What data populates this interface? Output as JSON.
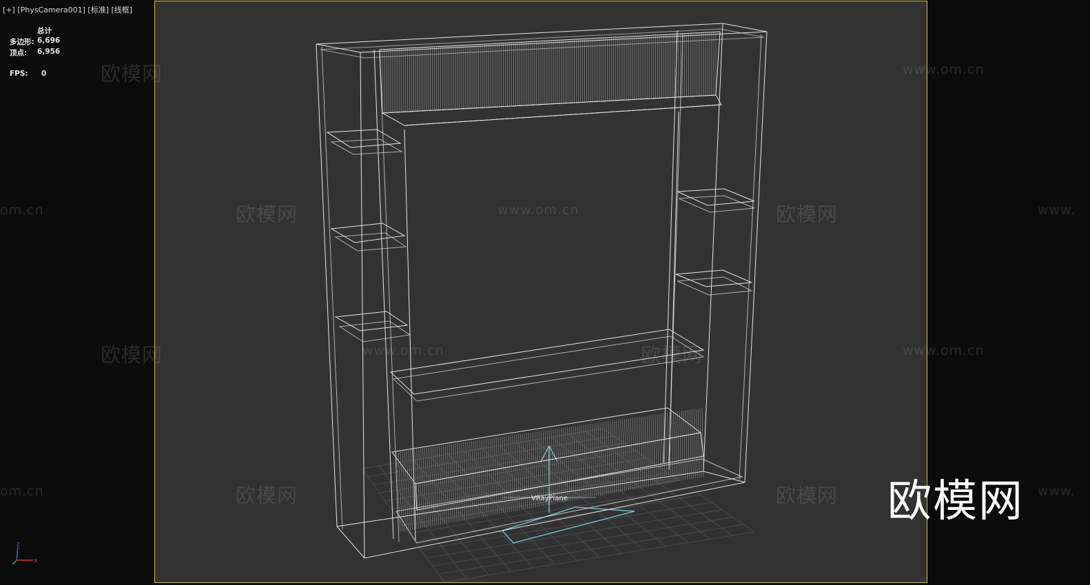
{
  "viewport": {
    "label_plus": "[+]",
    "label_camera": "[PhysCamera001]",
    "label_shading": "[标准]",
    "label_mode": "[线框]"
  },
  "stats": {
    "header": "总计",
    "polygons_label": "多边形:",
    "polygons_value": "6,696",
    "vertices_label": "顶点:",
    "vertices_value": "6,956",
    "fps_label": "FPS:",
    "fps_value": "0"
  },
  "scene": {
    "object_label": "VRayPlane",
    "wire_color": "#e8e8e8",
    "plane_color": "#7fd3e0",
    "grid_color": "#4a4a4a",
    "border_color": "#d3c14a"
  },
  "watermarks": {
    "brand_cn": "欧模网",
    "url": "www.om.cn",
    "url_partial_left": "om.cn",
    "url_partial_right": "www."
  },
  "gizmo": {
    "x": "x",
    "z": "z",
    "x_color": "#d23a3a",
    "z_color": "#3a6fd2"
  }
}
